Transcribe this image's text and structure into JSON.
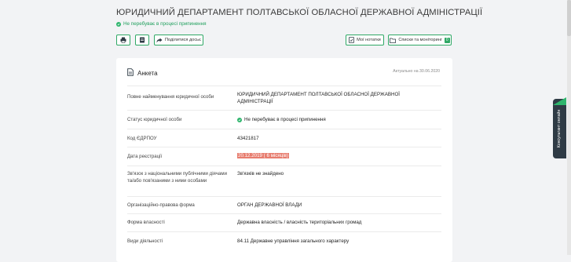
{
  "header": {
    "title": "ЮРИДИЧНИЙ ДЕПАРТАМЕНТ ПОЛТАВСЬКОЇ ОБЛАСНОЇ ДЕРЖАВНОЇ АДМІНІСТРАЦІЇ",
    "status": "Не перебуває в процесі припинення"
  },
  "toolbar": {
    "share_label": "Поділитися досьє",
    "notes_label": "Мої нотатки",
    "lists_label": "Списки та моніторинг",
    "lists_count": "0"
  },
  "card": {
    "title": "Анкета",
    "actual": "Актуально на 30.06.2020",
    "rows": [
      {
        "label": "Повне найменування юридичної особи",
        "value": "ЮРИДИЧНИЙ ДЕПАРТАМЕНТ ПОЛТАВСЬКОЇ ОБЛАСНОЇ ДЕРЖАВНОЇ АДМІНІСТРАЦІЇ"
      },
      {
        "label": "Статус юридичної особи",
        "value": "Не перебуває в процесі припинення"
      },
      {
        "label": "Код ЄДРПОУ",
        "value": "43421817"
      },
      {
        "label": "Дата реєстрації",
        "value": "20.12.2019 ( 6 місяців)"
      },
      {
        "label": "Зв'язок з національними публічними діячами та/або пов'язаними з ними особами",
        "value": "Зв'язків не знайдено"
      },
      {
        "label": "Організаційно-правова форма",
        "value": "ОРГАН ДЕРЖАВНОЇ ВЛАДИ"
      },
      {
        "label": "Форма власності",
        "value": "Державна власність / власність територіальних громад"
      },
      {
        "label": "Види діяльності",
        "value": "84.11 Державне управління загального характеру"
      }
    ]
  },
  "chat": {
    "label": "Консультант онлайн"
  },
  "colors": {
    "accent": "#2fa865",
    "highlight": "#e77c6e",
    "status": "#1f9f5c"
  }
}
